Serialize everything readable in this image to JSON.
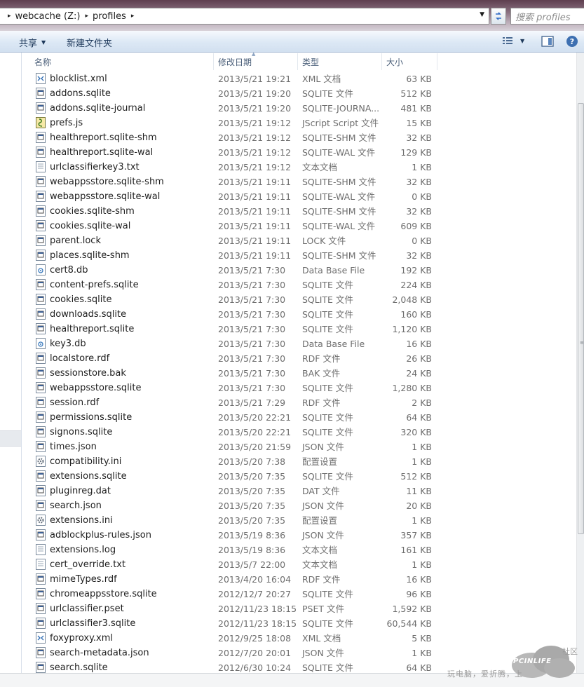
{
  "address": {
    "segments": [
      "webcache (Z:)",
      "profiles"
    ],
    "search_placeholder": "搜索 profiles"
  },
  "toolbar": {
    "share_label": "共享",
    "new_folder_label": "新建文件夹"
  },
  "columns": {
    "name": "名称",
    "date": "修改日期",
    "type": "类型",
    "size": "大小"
  },
  "files": [
    {
      "name": "blocklist.xml",
      "date": "2013/5/21 19:21",
      "type": "XML 文档",
      "size": "63 KB",
      "icon": "xml-file-icon"
    },
    {
      "name": "addons.sqlite",
      "date": "2013/5/21 19:20",
      "type": "SQLITE 文件",
      "size": "512 KB",
      "icon": "generic-file-icon"
    },
    {
      "name": "addons.sqlite-journal",
      "date": "2013/5/21 19:20",
      "type": "SQLITE-JOURNA...",
      "size": "481 KB",
      "icon": "generic-file-icon"
    },
    {
      "name": "prefs.js",
      "date": "2013/5/21 19:12",
      "type": "JScript Script 文件",
      "size": "15 KB",
      "icon": "script-file-icon"
    },
    {
      "name": "healthreport.sqlite-shm",
      "date": "2013/5/21 19:12",
      "type": "SQLITE-SHM 文件",
      "size": "32 KB",
      "icon": "generic-file-icon"
    },
    {
      "name": "healthreport.sqlite-wal",
      "date": "2013/5/21 19:12",
      "type": "SQLITE-WAL 文件",
      "size": "129 KB",
      "icon": "generic-file-icon"
    },
    {
      "name": "urlclassifierkey3.txt",
      "date": "2013/5/21 19:12",
      "type": "文本文档",
      "size": "1 KB",
      "icon": "text-file-icon"
    },
    {
      "name": "webappsstore.sqlite-shm",
      "date": "2013/5/21 19:11",
      "type": "SQLITE-SHM 文件",
      "size": "32 KB",
      "icon": "generic-file-icon"
    },
    {
      "name": "webappsstore.sqlite-wal",
      "date": "2013/5/21 19:11",
      "type": "SQLITE-WAL 文件",
      "size": "0 KB",
      "icon": "generic-file-icon"
    },
    {
      "name": "cookies.sqlite-shm",
      "date": "2013/5/21 19:11",
      "type": "SQLITE-SHM 文件",
      "size": "32 KB",
      "icon": "generic-file-icon"
    },
    {
      "name": "cookies.sqlite-wal",
      "date": "2013/5/21 19:11",
      "type": "SQLITE-WAL 文件",
      "size": "609 KB",
      "icon": "generic-file-icon"
    },
    {
      "name": "parent.lock",
      "date": "2013/5/21 19:11",
      "type": "LOCK 文件",
      "size": "0 KB",
      "icon": "generic-file-icon"
    },
    {
      "name": "places.sqlite-shm",
      "date": "2013/5/21 19:11",
      "type": "SQLITE-SHM 文件",
      "size": "32 KB",
      "icon": "generic-file-icon"
    },
    {
      "name": "cert8.db",
      "date": "2013/5/21 7:30",
      "type": "Data Base File",
      "size": "192 KB",
      "icon": "database-file-icon"
    },
    {
      "name": "content-prefs.sqlite",
      "date": "2013/5/21 7:30",
      "type": "SQLITE 文件",
      "size": "224 KB",
      "icon": "generic-file-icon"
    },
    {
      "name": "cookies.sqlite",
      "date": "2013/5/21 7:30",
      "type": "SQLITE 文件",
      "size": "2,048 KB",
      "icon": "generic-file-icon"
    },
    {
      "name": "downloads.sqlite",
      "date": "2013/5/21 7:30",
      "type": "SQLITE 文件",
      "size": "160 KB",
      "icon": "generic-file-icon"
    },
    {
      "name": "healthreport.sqlite",
      "date": "2013/5/21 7:30",
      "type": "SQLITE 文件",
      "size": "1,120 KB",
      "icon": "generic-file-icon"
    },
    {
      "name": "key3.db",
      "date": "2013/5/21 7:30",
      "type": "Data Base File",
      "size": "16 KB",
      "icon": "database-file-icon"
    },
    {
      "name": "localstore.rdf",
      "date": "2013/5/21 7:30",
      "type": "RDF 文件",
      "size": "26 KB",
      "icon": "generic-file-icon"
    },
    {
      "name": "sessionstore.bak",
      "date": "2013/5/21 7:30",
      "type": "BAK 文件",
      "size": "24 KB",
      "icon": "generic-file-icon"
    },
    {
      "name": "webappsstore.sqlite",
      "date": "2013/5/21 7:30",
      "type": "SQLITE 文件",
      "size": "1,280 KB",
      "icon": "generic-file-icon"
    },
    {
      "name": "session.rdf",
      "date": "2013/5/21 7:29",
      "type": "RDF 文件",
      "size": "2 KB",
      "icon": "generic-file-icon"
    },
    {
      "name": "permissions.sqlite",
      "date": "2013/5/20 22:21",
      "type": "SQLITE 文件",
      "size": "64 KB",
      "icon": "generic-file-icon"
    },
    {
      "name": "signons.sqlite",
      "date": "2013/5/20 22:21",
      "type": "SQLITE 文件",
      "size": "320 KB",
      "icon": "generic-file-icon"
    },
    {
      "name": "times.json",
      "date": "2013/5/20 21:59",
      "type": "JSON 文件",
      "size": "1 KB",
      "icon": "generic-file-icon"
    },
    {
      "name": "compatibility.ini",
      "date": "2013/5/20 7:38",
      "type": "配置设置",
      "size": "1 KB",
      "icon": "settings-file-icon"
    },
    {
      "name": "extensions.sqlite",
      "date": "2013/5/20 7:35",
      "type": "SQLITE 文件",
      "size": "512 KB",
      "icon": "generic-file-icon"
    },
    {
      "name": "pluginreg.dat",
      "date": "2013/5/20 7:35",
      "type": "DAT 文件",
      "size": "11 KB",
      "icon": "generic-file-icon"
    },
    {
      "name": "search.json",
      "date": "2013/5/20 7:35",
      "type": "JSON 文件",
      "size": "20 KB",
      "icon": "generic-file-icon"
    },
    {
      "name": "extensions.ini",
      "date": "2013/5/20 7:35",
      "type": "配置设置",
      "size": "1 KB",
      "icon": "settings-file-icon"
    },
    {
      "name": "adblockplus-rules.json",
      "date": "2013/5/19 8:36",
      "type": "JSON 文件",
      "size": "357 KB",
      "icon": "generic-file-icon"
    },
    {
      "name": "extensions.log",
      "date": "2013/5/19 8:36",
      "type": "文本文档",
      "size": "161 KB",
      "icon": "text-file-icon"
    },
    {
      "name": "cert_override.txt",
      "date": "2013/5/7 22:00",
      "type": "文本文档",
      "size": "1 KB",
      "icon": "text-file-icon"
    },
    {
      "name": "mimeTypes.rdf",
      "date": "2013/4/20 16:04",
      "type": "RDF 文件",
      "size": "16 KB",
      "icon": "generic-file-icon"
    },
    {
      "name": "chromeappsstore.sqlite",
      "date": "2012/12/7 20:27",
      "type": "SQLITE 文件",
      "size": "96 KB",
      "icon": "generic-file-icon"
    },
    {
      "name": "urlclassifier.pset",
      "date": "2012/11/23 18:15",
      "type": "PSET 文件",
      "size": "1,592 KB",
      "icon": "generic-file-icon"
    },
    {
      "name": "urlclassifier3.sqlite",
      "date": "2012/11/23 18:15",
      "type": "SQLITE 文件",
      "size": "60,544 KB",
      "icon": "generic-file-icon"
    },
    {
      "name": "foxyproxy.xml",
      "date": "2012/9/25 18:08",
      "type": "XML 文档",
      "size": "5 KB",
      "icon": "xml-file-icon"
    },
    {
      "name": "search-metadata.json",
      "date": "2012/7/20 20:01",
      "type": "JSON 文件",
      "size": "1 KB",
      "icon": "generic-file-icon"
    },
    {
      "name": "search.sqlite",
      "date": "2012/6/30 10:24",
      "type": "SQLITE 文件",
      "size": "64 KB",
      "icon": "generic-file-icon"
    }
  ],
  "watermark": {
    "logo": "PCINLIFE",
    "tag": "社区",
    "slogan": "玩电脑，爱折腾，上"
  }
}
